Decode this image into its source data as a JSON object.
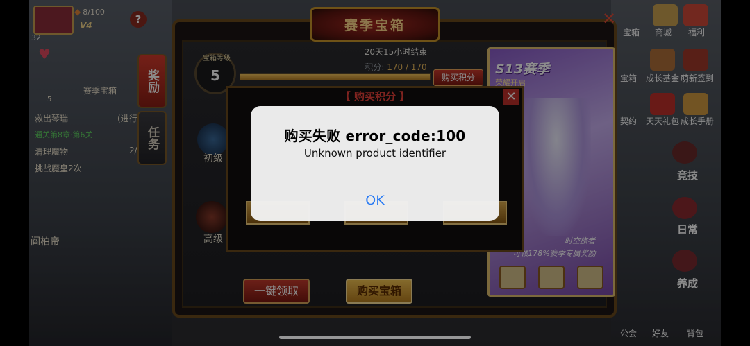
{
  "player": {
    "stamina": "8/100",
    "vip": "V4",
    "level": "32"
  },
  "tasks": {
    "header": "赛季宝箱",
    "rows": [
      {
        "text": "救出琴瑞",
        "status": "(进行",
        "green": false
      },
      {
        "text": "通关第8章·第6关",
        "status": "",
        "green": true
      },
      {
        "text": "清理魔物",
        "status": "2/",
        "green": false
      },
      {
        "text": "挑战魔皇2次",
        "status": "",
        "green": false
      }
    ],
    "small_count": "5"
  },
  "chest_dialog": {
    "title": "赛季宝箱",
    "time_left": "20天15小时结束",
    "points_label": "积分:",
    "points_value": "170 / 170",
    "points_progress": 1.0,
    "buy_points_button": "购买积分",
    "level_caption": "宝箱等级",
    "level_value": "5",
    "tabs": [
      {
        "label": "奖励",
        "active": true
      },
      {
        "label": "任务",
        "active": false
      }
    ],
    "tiers": [
      "初级",
      "高级"
    ],
    "claim_all_button": "一键领取",
    "buy_chest_button": "购买宝箱"
  },
  "season_card": {
    "title": "S13赛季",
    "subtitle": "荣耀开启",
    "character_name": "时空旅者",
    "description": "可领178%赛季专属奖励"
  },
  "right_menu": {
    "top_items": [
      "宝箱",
      "商城",
      "福利"
    ],
    "row2_items": [
      "宝箱",
      "成长基金",
      "萌新签到"
    ],
    "row3_items": [
      "契约",
      "天天礼包",
      "成长手册"
    ],
    "big_items": [
      "竞技",
      "日常",
      "养成"
    ],
    "bottom_items": [
      "公会",
      "好友",
      "背包"
    ]
  },
  "left_bottom_text": "阎柏帝",
  "buy_points_popup": {
    "title": "【 购买积分 】"
  },
  "alert": {
    "title": "购买失败   error_code:100",
    "message": "Unknown product identifier",
    "ok_button": "OK"
  },
  "colors": {
    "alert_button": "#2a7bf3",
    "accent_red": "#c33a2c",
    "accent_gold": "#f0c050"
  }
}
